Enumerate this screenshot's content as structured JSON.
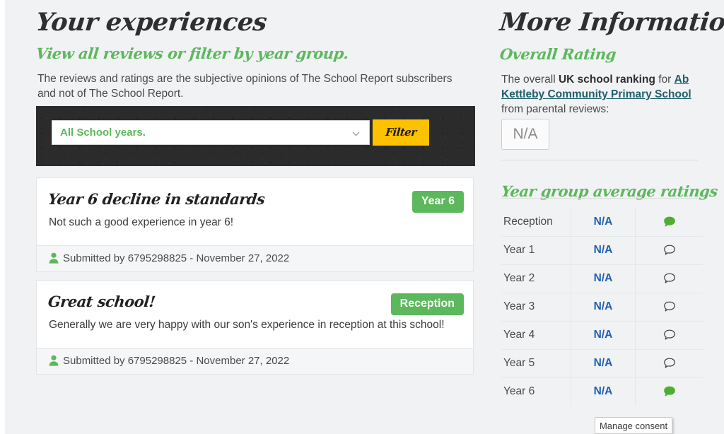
{
  "left": {
    "title": "Your experiences",
    "subtitle": "View all reviews or filter by year group.",
    "intro": "The reviews and ratings are the subjective opinions of The School Report subscribers and not of The School Report.",
    "filter": {
      "selected_year": "All School years.",
      "select_icon": "chevron-down-icon",
      "button_label": "Filter"
    },
    "reviews": [
      {
        "title": "Year 6 decline in standards",
        "badge": "Year 6",
        "text": "Not such a good experience in year 6!",
        "meta": "Submitted by 6795298825 - November 27, 2022",
        "meta_icon": "person-icon"
      },
      {
        "title": "Great school!",
        "badge": "Reception",
        "text": "Generally we are very happy with our son's experience in reception at this school!",
        "meta": "Submitted by 6795298825 - November 27, 2022",
        "meta_icon": "person-icon"
      }
    ]
  },
  "right": {
    "title": "More Information",
    "overall_rating_heading": "Overall Rating",
    "ranking_text_before": "The overall ",
    "ranking_text_bold": "UK school ranking",
    "ranking_text_mid": " for ",
    "school_link": "Ab Kettleby Community Primary School",
    "ranking_text_after": " from parental reviews:",
    "overall_rating_value": "N/A",
    "year_ratings_heading": "Year group average ratings",
    "year_rows": [
      {
        "year": "Reception",
        "rating": "N/A",
        "icon": "speech-bubble-icon",
        "has_reviews": true
      },
      {
        "year": "Year 1",
        "rating": "N/A",
        "icon": "speech-bubble-icon",
        "has_reviews": false
      },
      {
        "year": "Year 2",
        "rating": "N/A",
        "icon": "speech-bubble-icon",
        "has_reviews": false
      },
      {
        "year": "Year 3",
        "rating": "N/A",
        "icon": "speech-bubble-icon",
        "has_reviews": false
      },
      {
        "year": "Year 4",
        "rating": "N/A",
        "icon": "speech-bubble-icon",
        "has_reviews": false
      },
      {
        "year": "Year 5",
        "rating": "N/A",
        "icon": "speech-bubble-icon",
        "has_reviews": false
      },
      {
        "year": "Year 6",
        "rating": "N/A",
        "icon": "speech-bubble-icon",
        "has_reviews": true
      }
    ]
  },
  "consent": {
    "label": "Manage consent"
  },
  "colors": {
    "brand_green": "#5cb85c",
    "accent_yellow": "#fcc200",
    "link_blue": "#1f60b5",
    "school_link": "#1f5f6b",
    "dark_bar": "#2b2b2b",
    "page_bg": "#f1f2f4"
  }
}
